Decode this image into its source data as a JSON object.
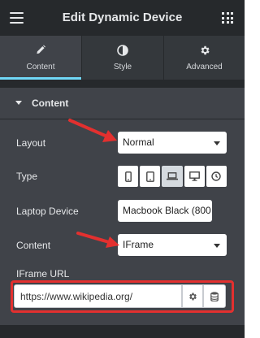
{
  "header": {
    "title": "Edit Dynamic Device",
    "menu_icon": "hamburger-icon",
    "apps_icon": "grid-icon"
  },
  "tabs": [
    {
      "label": "Content",
      "icon": "pencil-icon",
      "active": true
    },
    {
      "label": "Style",
      "icon": "half-circle-icon",
      "active": false
    },
    {
      "label": "Advanced",
      "icon": "gear-icon",
      "active": false
    }
  ],
  "section": {
    "title": "Content",
    "expanded": true
  },
  "controls": {
    "layout": {
      "label": "Layout",
      "value": "Normal"
    },
    "type": {
      "label": "Type",
      "options": [
        "mobile-icon",
        "tablet-icon",
        "laptop-icon",
        "desktop-icon",
        "watch-icon"
      ],
      "selected_index": 2
    },
    "laptop_device": {
      "label": "Laptop Device",
      "value": "Macbook Black (800"
    },
    "content": {
      "label": "Content",
      "value": "IFrame"
    },
    "iframe_url": {
      "label": "IFrame URL",
      "value": "https://www.wikipedia.org/"
    }
  },
  "colors": {
    "accent": "#71d7f7",
    "annotation": "#e3302f",
    "panel_bg": "#404349",
    "header_bg": "#26292c"
  }
}
